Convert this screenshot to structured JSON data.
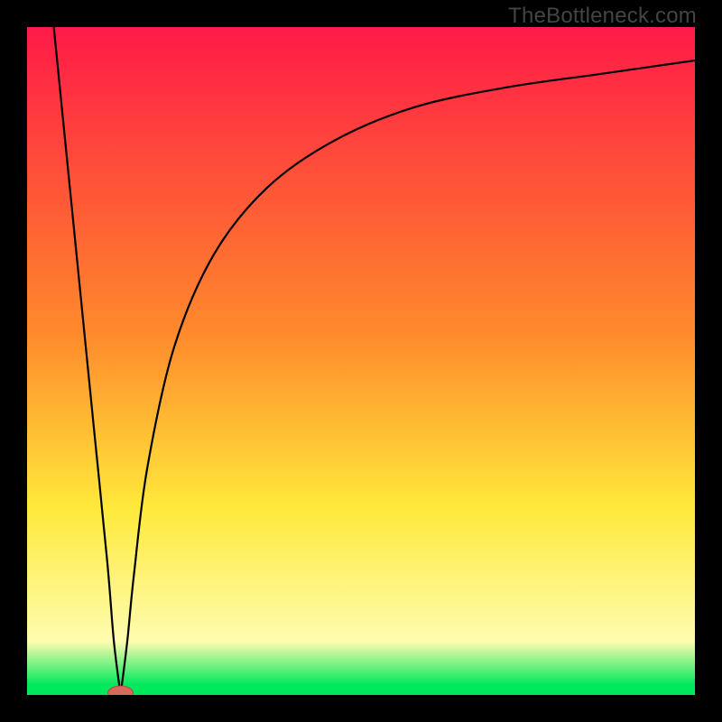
{
  "watermark": "TheBottleneck.com",
  "colors": {
    "frame": "#000000",
    "grad_top": "#ff1a47",
    "grad_mid_orange": "#ff8a2b",
    "grad_mid_yellow": "#ffe93b",
    "grad_pale": "#fffcb0",
    "grad_green": "#00e85c",
    "curve": "#000000",
    "marker_fill": "#d46a5c",
    "marker_stroke": "#b14d40"
  },
  "chart_data": {
    "type": "line",
    "title": "",
    "xlabel": "",
    "ylabel": "",
    "xlim": [
      0,
      100
    ],
    "ylim": [
      0,
      100
    ],
    "dip_x": 14,
    "left_curve": {
      "x": [
        4,
        6,
        8,
        10,
        12,
        13,
        14
      ],
      "y": [
        100,
        80,
        60,
        40,
        20,
        8,
        0
      ]
    },
    "right_curve": {
      "x": [
        14,
        15,
        16,
        18,
        22,
        28,
        36,
        46,
        58,
        72,
        86,
        100
      ],
      "y": [
        0,
        8,
        18,
        34,
        52,
        66,
        76,
        83,
        88,
        91,
        93,
        95
      ]
    },
    "marker": {
      "x": 14,
      "y": 0
    },
    "background_gradient_stops": [
      {
        "pos": 0.0,
        "color": "#ff1a47"
      },
      {
        "pos": 0.46,
        "color": "#ff8a2b"
      },
      {
        "pos": 0.72,
        "color": "#ffe93b"
      },
      {
        "pos": 0.92,
        "color": "#fffcb0"
      },
      {
        "pos": 0.985,
        "color": "#00e85c"
      }
    ]
  }
}
